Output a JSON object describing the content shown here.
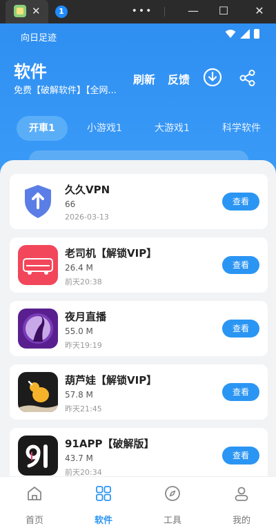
{
  "window": {
    "tab_close": "✕",
    "tab_badge": "1",
    "more": "•••",
    "minimize": "—",
    "maximize": "☐",
    "close": "✕"
  },
  "status_bar": {
    "text": "向日足迹"
  },
  "header": {
    "title": "软件",
    "subtitle": "免费【破解软件】【全网...",
    "refresh_label": "刷新",
    "feedback_label": "反馈"
  },
  "categories": [
    {
      "label": "开車1",
      "active": true
    },
    {
      "label": "小游戏1",
      "active": false
    },
    {
      "label": "大游戏1",
      "active": false
    },
    {
      "label": "科学软件",
      "active": false
    }
  ],
  "apps": [
    {
      "name": "久久VPN",
      "size": "66",
      "date": "2026-03-13",
      "button": "查看",
      "icon": "shield-upload-icon",
      "color": "#5b7ee6"
    },
    {
      "name": "老司机【解锁VIP】",
      "size": "26.4 M",
      "date": "前天20:38",
      "button": "查看",
      "icon": "old-driver-logo-icon",
      "color": "#f2465a"
    },
    {
      "name": "夜月直播",
      "size": "55.0 M",
      "date": "昨天19:19",
      "button": "查看",
      "icon": "moon-live-logo-icon",
      "color": "#5a1f8f"
    },
    {
      "name": "葫芦娃【解锁VIP】",
      "size": "57.8 M",
      "date": "昨天21:45",
      "button": "查看",
      "icon": "gourd-logo-icon",
      "color": "#1c1c1c"
    },
    {
      "name": "91APP【破解版】",
      "size": "43.7 M",
      "date": "前天20:34",
      "button": "查看",
      "icon": "91-logo-icon",
      "color": "#1a1a1a"
    }
  ],
  "nav": [
    {
      "label": "首页",
      "icon": "home-icon",
      "active": false
    },
    {
      "label": "软件",
      "icon": "grid-icon",
      "active": true
    },
    {
      "label": "工具",
      "icon": "compass-icon",
      "active": false
    },
    {
      "label": "我的",
      "icon": "user-icon",
      "active": false
    }
  ],
  "colors": {
    "primary": "#2f8ff2",
    "button": "#2b95f3",
    "background": "#f2f3f5"
  }
}
